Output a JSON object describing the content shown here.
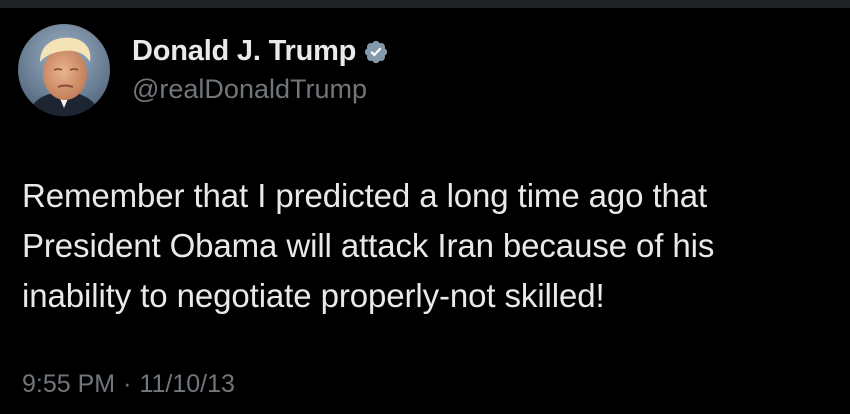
{
  "tweet": {
    "author": {
      "display_name": "Donald J. Trump",
      "handle": "@realDonaldTrump",
      "verified_icon": "verified-badge-icon",
      "avatar_icon": "profile-avatar"
    },
    "text_lines": [
      "Remember that I predicted a long time ago that",
      "President Obama will attack Iran because of his",
      "inability to negotiate properly-not skilled!"
    ],
    "time": "9:55 PM",
    "separator": "·",
    "date": "11/10/13"
  },
  "colors": {
    "background": "#000000",
    "primary_text": "#e7e9ea",
    "secondary_text": "#71767b",
    "verified_badge": "#829aab"
  }
}
